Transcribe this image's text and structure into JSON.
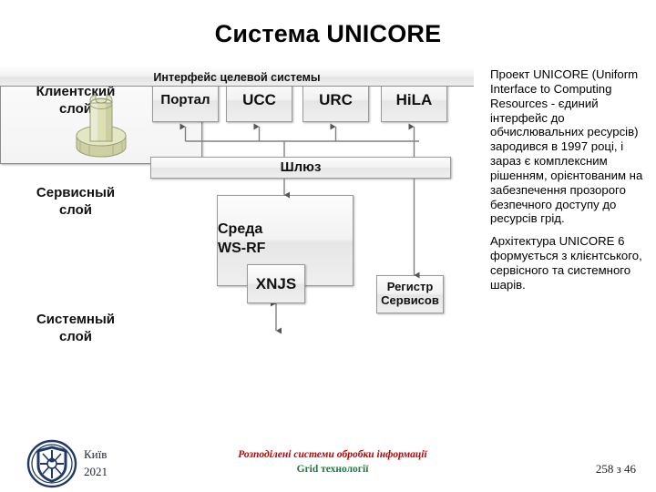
{
  "slide": {
    "title": "Система UNICORE"
  },
  "diagram": {
    "layers": [
      {
        "id": "client",
        "label": "Клиентский\nслой"
      },
      {
        "id": "service",
        "label": "Сервисный\nслой"
      },
      {
        "id": "system",
        "label": "Системный\nслой"
      }
    ],
    "layer_labels": {
      "client_line1": "Клиентский",
      "client_line2": "слой",
      "service_line1": "Сервисный",
      "service_line2": "слой",
      "system_line1": "Системный",
      "system_line2": "слой"
    },
    "client_boxes": [
      {
        "id": "portal",
        "label": "Портал"
      },
      {
        "id": "ucc",
        "label": "UCC"
      },
      {
        "id": "urc",
        "label": "URC"
      },
      {
        "id": "hila",
        "label": "HiLA"
      }
    ],
    "gateway": {
      "label": "Шлюз"
    },
    "wsrf": {
      "line1": "Среда",
      "line2": "WS-RF"
    },
    "xnjs": {
      "label": "XNJS"
    },
    "registry": {
      "line1": "Регистр",
      "line2": "Сервисов"
    },
    "system_panel": {
      "header": "Интерфейс целевой системы",
      "figure_name": "target-system-tower",
      "figure_color": "#dde0b8"
    },
    "colors": {
      "box_border": "#9a9a9a",
      "box_fill_top": "#fdfdfd",
      "box_fill_bottom": "#e6e6e6",
      "connector": "#808080",
      "arrow": "#555555"
    }
  },
  "body_text": {
    "paragraphs": [
      "Проект UNICORE (Uniform Interface to Computing Resources - єдиний інтерфейс до обчислювальних ресурсів) зародився в 1997 році, і зараз є комплексним рішенням, орієнтованим на забезпечення прозорого безпечного доступу до ресурсів грід.",
      "Архітектура UNICORE 6 формується з клієнтського, сервісного та системного шарів."
    ]
  },
  "footer": {
    "city": "Київ",
    "year": "2021",
    "course": "Розподілені системи обробки інформації",
    "topic": "Grid технології",
    "page": "258 з 46",
    "logo_name": "university-emblem",
    "colors": {
      "course": "#c00000",
      "topic": "#1f7a3d",
      "logo": "#1f3864"
    }
  }
}
